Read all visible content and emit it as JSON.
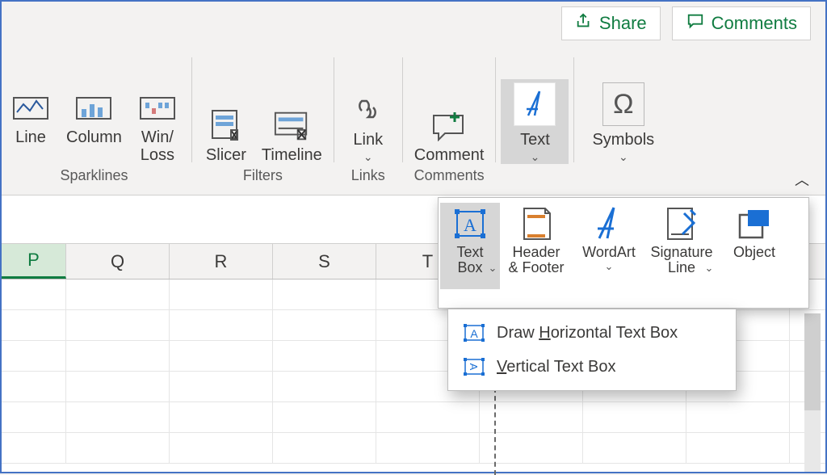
{
  "topright": {
    "share": "Share",
    "comments": "Comments"
  },
  "ribbon": {
    "groups": {
      "sparklines": {
        "label": "Sparklines",
        "items": {
          "line": "Line",
          "column": "Column",
          "winloss": "Win/\nLoss"
        }
      },
      "filters": {
        "label": "Filters",
        "items": {
          "slicer": "Slicer",
          "timeline": "Timeline"
        }
      },
      "links": {
        "label": "Links",
        "items": {
          "link": "Link"
        }
      },
      "comments": {
        "label": "Comments",
        "items": {
          "comment": "Comment"
        }
      },
      "text": {
        "items": {
          "text": "Text"
        }
      },
      "symbols": {
        "items": {
          "symbols": "Symbols"
        }
      }
    }
  },
  "columns": [
    "P",
    "Q",
    "R",
    "S",
    "T"
  ],
  "gallery": {
    "textbox": "Text\nBox",
    "headerfooter": "Header\n& Footer",
    "wordart": "WordArt",
    "sigline": "Signature\nLine",
    "object": "Object"
  },
  "submenu": {
    "horiz_pre": "Draw ",
    "horiz_ul": "H",
    "horiz_post": "orizontal Text Box",
    "vert_ul": "V",
    "vert_post": "ertical Text Box"
  },
  "colors": {
    "accent_green": "#107c41",
    "accent_blue": "#1a6fd4",
    "accent_orange": "#d97f2e"
  }
}
